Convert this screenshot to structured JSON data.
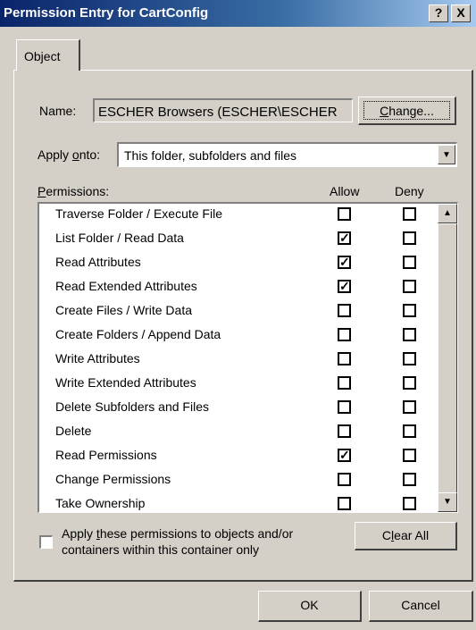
{
  "window": {
    "title": "Permission Entry for CartConfig",
    "help_glyph": "?",
    "close_glyph": "X"
  },
  "tabs": [
    {
      "label": "Object"
    }
  ],
  "name_label": "Name:",
  "name_value": "ESCHER Browsers (ESCHER\\ESCHER",
  "change_button": "Change...",
  "apply_onto": {
    "label": "Apply onto:",
    "value": "This folder, subfolders and files"
  },
  "permissions": {
    "header": "Permissions:",
    "allow_header": "Allow",
    "deny_header": "Deny",
    "rows": [
      {
        "name": "Traverse Folder / Execute File",
        "allow": false,
        "deny": false
      },
      {
        "name": "List Folder / Read Data",
        "allow": true,
        "deny": false
      },
      {
        "name": "Read Attributes",
        "allow": true,
        "deny": false
      },
      {
        "name": "Read Extended Attributes",
        "allow": true,
        "deny": false
      },
      {
        "name": "Create Files / Write Data",
        "allow": false,
        "deny": false
      },
      {
        "name": "Create Folders / Append Data",
        "allow": false,
        "deny": false
      },
      {
        "name": "Write Attributes",
        "allow": false,
        "deny": false
      },
      {
        "name": "Write Extended Attributes",
        "allow": false,
        "deny": false
      },
      {
        "name": "Delete Subfolders and Files",
        "allow": false,
        "deny": false
      },
      {
        "name": "Delete",
        "allow": false,
        "deny": false
      },
      {
        "name": "Read Permissions",
        "allow": true,
        "deny": false
      },
      {
        "name": "Change Permissions",
        "allow": false,
        "deny": false
      },
      {
        "name": "Take Ownership",
        "allow": false,
        "deny": false
      }
    ]
  },
  "apply_container_only": {
    "line1": "Apply these permissions to objects and/or",
    "line2": "containers within this container only",
    "checked": false
  },
  "clear_all_button": "Clear All",
  "ok_button": "OK",
  "cancel_button": "Cancel",
  "colors": {
    "title_start": "#0a246a",
    "title_end": "#a6caf0",
    "face": "#d4d0c8"
  }
}
